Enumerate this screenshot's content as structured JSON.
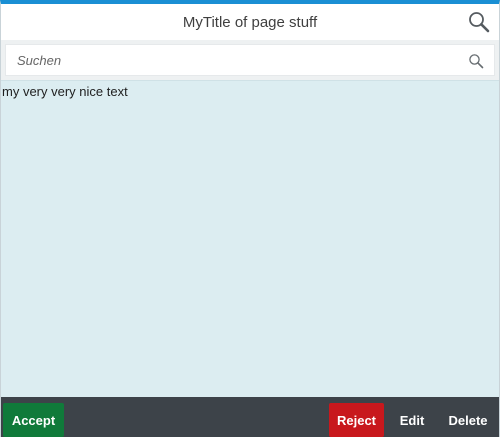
{
  "header": {
    "title": "MyTitle of page stuff",
    "search_icon": "search-icon"
  },
  "search": {
    "placeholder": "Suchen",
    "value": "",
    "icon": "search-icon"
  },
  "content": {
    "text": "my very very nice text"
  },
  "footer": {
    "accept_label": "Accept",
    "reject_label": "Reject",
    "edit_label": "Edit",
    "delete_label": "Delete"
  },
  "colors": {
    "accent_top_border": "#1a8fd4",
    "content_background": "#dcedf1",
    "footer_background": "#3d4349",
    "accept": "#107a3a",
    "reject": "#c8181d"
  }
}
